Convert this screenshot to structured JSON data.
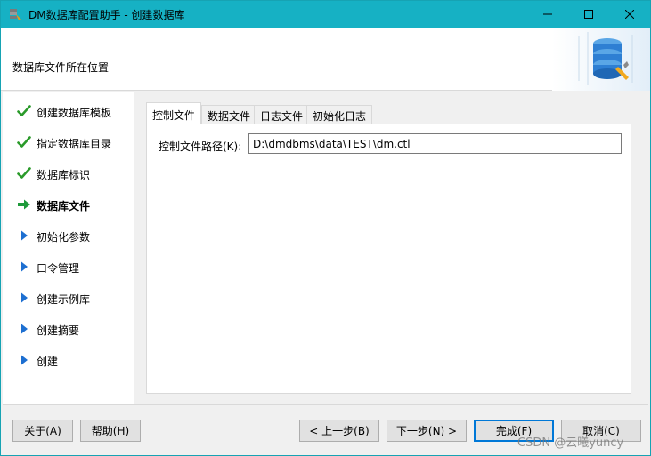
{
  "window": {
    "title": "DM数据库配置助手 - 创建数据库",
    "titlebar_color": "#16b1c4"
  },
  "header": {
    "title": "数据库文件所在位置"
  },
  "steps": [
    {
      "label": "创建数据库模板",
      "status": "done",
      "icon": "check-icon"
    },
    {
      "label": "指定数据库目录",
      "status": "done",
      "icon": "check-icon"
    },
    {
      "label": "数据库标识",
      "status": "done",
      "icon": "check-icon"
    },
    {
      "label": "数据库文件",
      "status": "current",
      "icon": "arrow-right-icon"
    },
    {
      "label": "初始化参数",
      "status": "pending",
      "icon": "triangle-right-icon"
    },
    {
      "label": "口令管理",
      "status": "pending",
      "icon": "triangle-right-icon"
    },
    {
      "label": "创建示例库",
      "status": "pending",
      "icon": "triangle-right-icon"
    },
    {
      "label": "创建摘要",
      "status": "pending",
      "icon": "triangle-right-icon"
    },
    {
      "label": "创建",
      "status": "pending",
      "icon": "triangle-right-icon"
    }
  ],
  "tabs": [
    {
      "label": "控制文件",
      "active": true
    },
    {
      "label": "数据文件",
      "active": false
    },
    {
      "label": "日志文件",
      "active": false
    },
    {
      "label": "初始化日志",
      "active": false
    }
  ],
  "control_file": {
    "label": "控制文件路径(K):",
    "value": "D:\\dmdbms\\data\\TEST\\dm.ctl"
  },
  "buttons": {
    "about": "关于(A)",
    "help": "帮助(H)",
    "prev": "< 上一步(B)",
    "next": "下一步(N) >",
    "finish": "完成(F)",
    "cancel": "取消(C)"
  },
  "watermark": "CSDN @云曦yuncy",
  "colors": {
    "check": "#2a9a2a",
    "current_arrow": "#1e9a3a",
    "pending_triangle": "#1d6fd1",
    "accent": "#0078d7"
  }
}
